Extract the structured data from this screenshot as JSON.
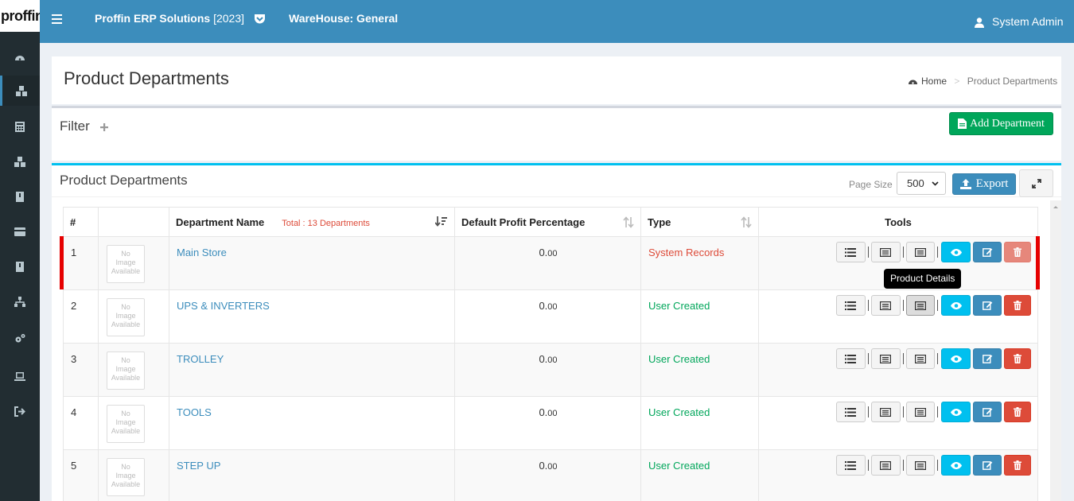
{
  "app": {
    "logo_text": "proffin",
    "title": "Proffin ERP Solutions",
    "year": "[2023]",
    "warehouse_label": "WareHouse: General",
    "user": "System Admin"
  },
  "sidebar": {
    "items": [
      {
        "icon": "dashboard-icon",
        "active": false
      },
      {
        "icon": "cubes-icon",
        "active": true
      },
      {
        "icon": "calculator-icon",
        "active": false
      },
      {
        "icon": "cubes-icon",
        "active": false
      },
      {
        "icon": "book-icon",
        "active": false
      },
      {
        "icon": "credit-card-icon",
        "active": false
      },
      {
        "icon": "book-icon",
        "active": false
      },
      {
        "icon": "sitemap-icon",
        "active": false
      },
      {
        "icon": "cogs-icon",
        "active": false
      },
      {
        "icon": "laptop-icon",
        "active": false
      },
      {
        "icon": "sign-out-icon",
        "active": false
      }
    ]
  },
  "header": {
    "page_title": "Product Departments",
    "breadcrumb_home": "Home",
    "breadcrumb_sep": ">",
    "breadcrumb_current": "Product Departments"
  },
  "filter": {
    "label": "Filter",
    "add_button": "Add Department"
  },
  "list": {
    "title": "Product Departments",
    "page_size_label": "Page Size",
    "page_size_value": "500",
    "export_label": "Export"
  },
  "table": {
    "headers": {
      "num": "#",
      "image": "",
      "name": "Department Name",
      "total": "Total : 13 Departments",
      "pct": "Default Profit Percentage",
      "type": "Type",
      "tools": "Tools"
    },
    "no_image": [
      "No",
      "Image",
      "Available"
    ],
    "rows": [
      {
        "num": "1",
        "name": "Main Store",
        "pct_int": "0.",
        "pct_dec": "00",
        "type": "System Records",
        "kind": "sys"
      },
      {
        "num": "2",
        "name": "UPS & INVERTERS",
        "pct_int": "0.",
        "pct_dec": "00",
        "type": "User Created",
        "kind": "usr"
      },
      {
        "num": "3",
        "name": "TROLLEY",
        "pct_int": "0.",
        "pct_dec": "00",
        "type": "User Created",
        "kind": "usr"
      },
      {
        "num": "4",
        "name": "TOOLS",
        "pct_int": "0.",
        "pct_dec": "00",
        "type": "User Created",
        "kind": "usr"
      },
      {
        "num": "5",
        "name": "STEP UP",
        "pct_int": "0.",
        "pct_dec": "00",
        "type": "User Created",
        "kind": "usr"
      }
    ]
  },
  "tooltip": "Product Details",
  "colors": {
    "primary": "#3c8dbc",
    "success": "#00a65a",
    "info": "#00c0ef",
    "danger": "#dd4b39",
    "sidebar": "#222d32"
  }
}
